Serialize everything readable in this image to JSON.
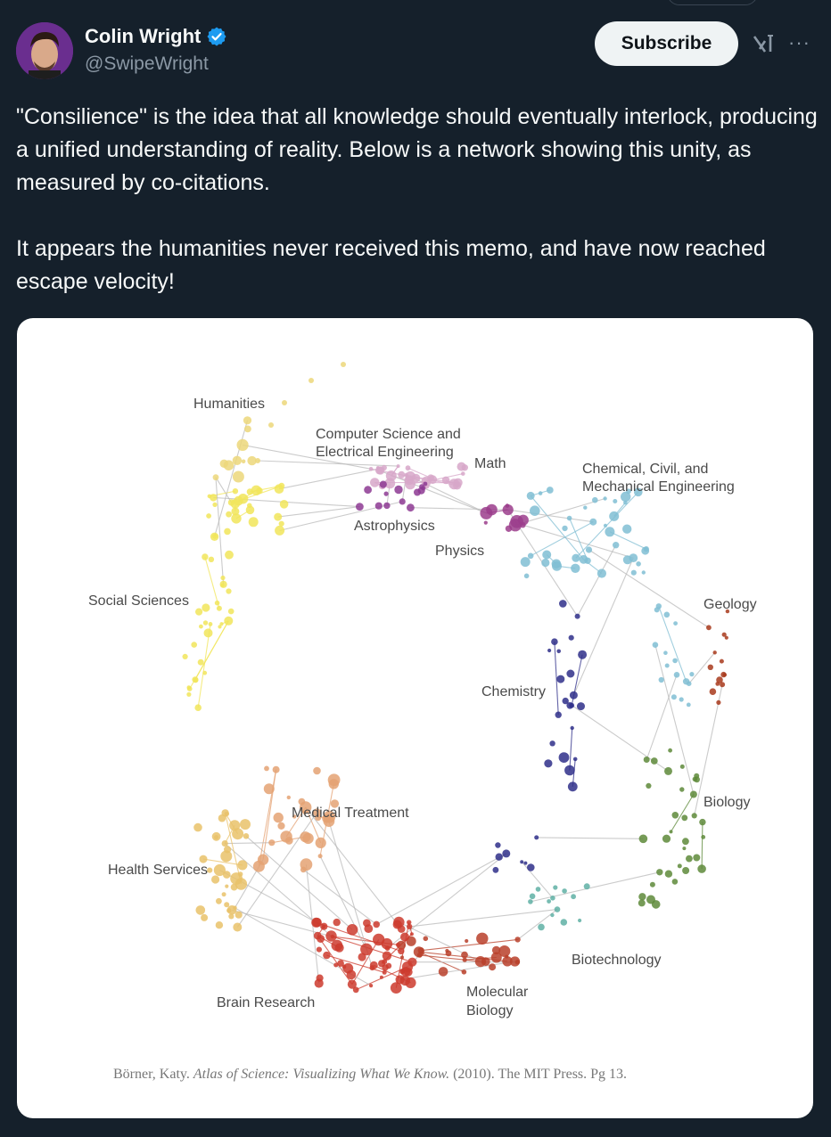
{
  "tweet": {
    "author_name": "Colin Wright",
    "handle": "@SwipeWright",
    "subscribe_label": "Subscribe",
    "more_glyph": "···",
    "text": "\"Consilience\" is the idea that all knowledge should eventually interlock, producing a unified understanding of reality. Below is a network showing this unity, as measured by co-citations.\n\nIt appears the humanities never received this memo, and have now reached escape velocity!"
  },
  "figure": {
    "labels": {
      "humanities": "Humanities",
      "cs_line1": "Computer Science and",
      "cs_line2": "Electrical Engineering",
      "math": "Math",
      "chem_eng_line1": "Chemical, Civil, and",
      "chem_eng_line2": "Mechanical Engineering",
      "astrophysics": "Astrophysics",
      "physics": "Physics",
      "social_sciences": "Social Sciences",
      "geology": "Geology",
      "chemistry": "Chemistry",
      "biology": "Biology",
      "medical_treatment": "Medical Treatment",
      "health_services": "Health Services",
      "biotechnology": "Biotechnology",
      "brain_research": "Brain Research",
      "molecular_line1": "Molecular",
      "molecular_line2": "Biology"
    },
    "citation": {
      "author": "Börner, Katy. ",
      "title": "Atlas of Science: Visualizing What We Know.",
      "rest": " (2010). The MIT Press. Pg 13."
    },
    "colors": {
      "humanities": "#ecd77a",
      "social_sciences": "#f1e55a",
      "cs_ee": "#d7a7c9",
      "astrophysics": "#8d3a93",
      "physics": "#9b3d8c",
      "chem_eng": "#80bed3",
      "geology": "#a83a1c",
      "chemistry": "#2f2f8a",
      "biology": "#5e8a3a",
      "biotechnology": "#5fb0a5",
      "molecular_biology": "#b8402a",
      "brain_research": "#cc3b2e",
      "medical_treatment": "#e4a273",
      "health_services": "#e9c26a",
      "cross_links": "#b9b9b9"
    }
  },
  "icons": {
    "verified": "verified-badge-icon",
    "grok": "grok-icon",
    "more": "more-icon"
  }
}
